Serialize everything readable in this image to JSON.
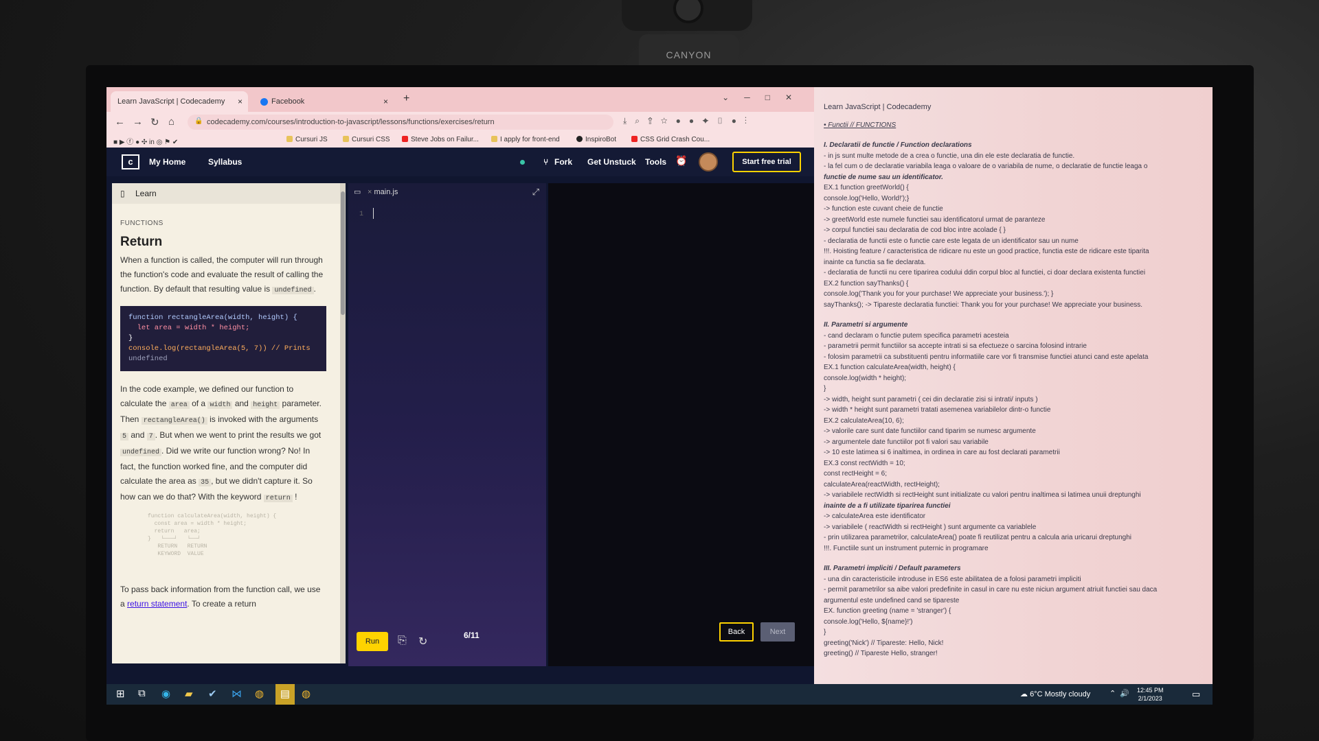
{
  "webcam": {
    "brand": "CANYON"
  },
  "chrome": {
    "tabs": [
      {
        "title": "Learn JavaScript | Codecademy",
        "active": true
      },
      {
        "title": "Facebook",
        "active": false
      }
    ],
    "url": "codecademy.com/courses/introduction-to-javascript/lessons/functions/exercises/return",
    "bookmarks": [
      "Cursuri JS",
      "Cursuri CSS",
      "Steve Jobs on Failur...",
      "I apply for front-end",
      "InspiroBot",
      "CSS Grid Crash Cou..."
    ]
  },
  "codecademy": {
    "nav": {
      "my_home": "My Home",
      "syllabus": "Syllabus",
      "fork": "Fork",
      "get_unstuck": "Get Unstuck",
      "tools": "Tools",
      "cta": "Start free trial"
    },
    "learn": {
      "header": "Learn",
      "kicker": "FUNCTIONS",
      "title": "Return",
      "p1_a": "When a function is called, the computer will run through the function's code and evaluate the result of calling the function. By default that resulting value is",
      "p1_code": "undefined",
      "code_lines": [
        "function rectangleArea(width, height) {",
        "  let area = width * height;",
        "}",
        "console.log(rectangleArea(5, 7)) // Prints",
        "undefined"
      ],
      "p2": [
        "In the code example, we defined our function to calculate the",
        "area",
        "of a",
        "width",
        "and",
        "height",
        "parameter. Then",
        "rectangleArea()",
        "is invoked with the arguments",
        "5",
        "and",
        "7",
        ". But when we went to print the results we got",
        "undefined",
        ". Did we write our function wrong? No! In fact, the function worked fine, and the computer did calculate the area as",
        "35",
        ", but we didn't capture it. So how can we do that? With the keyword",
        "return",
        "!"
      ],
      "diagram": "function calculateArea(width, height) {\n  const area = width * height;\n  return   area;\n}   └───┘   └──┘\n   RETURN   RETURN\n   KEYWORD  VALUE",
      "p3_a": "To pass back information from the function call, we use a",
      "p3_link": "return statement",
      "p3_b": ". To create a return"
    },
    "editor": {
      "file": "main.js",
      "line": "1",
      "run": "Run"
    },
    "footer": {
      "progress": "6/11",
      "back": "Back",
      "next": "Next"
    }
  },
  "notes": {
    "title": "Learn JavaScript | Codecademy",
    "lines": [
      {
        "t": "• Functii // FUNCTIONS",
        "c": "ul it"
      },
      {
        "t": "",
        "c": ""
      },
      {
        "t": "I. Declaratii de functie / Function declarations",
        "c": "sh"
      },
      {
        "t": "- in js sunt multe metode de a crea o functie, una din ele este declaratia de functie.",
        "c": ""
      },
      {
        "t": "- la fel cum o de declaratie variabila leaga o valoare de o variabila de nume, o declaratie de functie leaga o",
        "c": ""
      },
      {
        "t": "functie de nume sau un identificator.",
        "c": "bi"
      },
      {
        "t": "EX.1 function greetWorld() {",
        "c": ""
      },
      {
        "t": "          console.log('Hello, World!');}",
        "c": ""
      },
      {
        "t": "-> function este cuvant cheie de functie",
        "c": ""
      },
      {
        "t": "-> greetWorld este numele functiei sau identificatorul urmat de paranteze",
        "c": ""
      },
      {
        "t": "-> corpul functiei sau declaratia de cod bloc intre acolade { }",
        "c": ""
      },
      {
        "t": "- declaratia de  functii este o functie care este legata de un identificator sau un nume",
        "c": ""
      },
      {
        "t": "!!!. Hoisting feature / caracteristica de ridicare nu este un good practice, functia este de ridicare este tiparita",
        "c": ""
      },
      {
        "t": "inainte ca functia sa fie declarata.",
        "c": ""
      },
      {
        "t": "- declaratia de functii nu cere tiparirea codului ddin corpul bloc al functiei, ci doar declara existenta functiei",
        "c": ""
      },
      {
        "t": "EX.2 function sayThanks() {",
        "c": ""
      },
      {
        "t": "  console.log('Thank you for your purchase! We appreciate your business.'); }",
        "c": ""
      },
      {
        "t": "sayThanks(); -> Tipareste declaratia functiei: Thank you for your purchase! We appreciate your business.",
        "c": ""
      },
      {
        "t": "",
        "c": ""
      },
      {
        "t": "II. Parametri si argumente",
        "c": "sh"
      },
      {
        "t": "- cand declaram o functie putem specifica parametri acesteia",
        "c": ""
      },
      {
        "t": "- parametrii permit functiilor sa accepte intrati si sa efectueze o sarcina folosind intrarie",
        "c": ""
      },
      {
        "t": "- folosim parametrii ca substituenti pentru informatiile care vor fi transmise functiei atunci cand este apelata",
        "c": ""
      },
      {
        "t": "EX.1 function calculateArea(width, height) {",
        "c": ""
      },
      {
        "t": "          console.log(width * height);",
        "c": ""
      },
      {
        "t": "}",
        "c": ""
      },
      {
        "t": "-> width, height sunt parametri ( cei din declaratie zisi si intrati/ inputs )",
        "c": ""
      },
      {
        "t": "-> width * height sunt parametri tratati asemenea variabilelor dintr-o functie",
        "c": ""
      },
      {
        "t": "EX.2 calculateArea(10, 6);",
        "c": ""
      },
      {
        "t": "-> valorile care sunt date functiilor cand tiparim se numesc argumente",
        "c": ""
      },
      {
        "t": "-> argumentele date functiilor pot fi valori sau variabile",
        "c": ""
      },
      {
        "t": "-> 10 este latimea si 6 inaltimea, in ordinea in care au fost declarati parametrii",
        "c": ""
      },
      {
        "t": "EX.3 const rectWidth = 10;",
        "c": ""
      },
      {
        "t": "        const rectHeight = 6;",
        "c": ""
      },
      {
        "t": "        calculateArea(reactWidth, rectHeight);",
        "c": ""
      },
      {
        "t": "-> variabilele rectWidth si rectHeight sunt initializate cu valori pentru inaltimea si latimea unuii dreptunghi",
        "c": ""
      },
      {
        "t": "inainte de a fi utilizate tiparirea functiei",
        "c": "bi"
      },
      {
        "t": "-> calculateArea este identificator",
        "c": ""
      },
      {
        "t": "-> variabilele ( reactWidth si rectHeight ) sunt argumente ca variablele",
        "c": ""
      },
      {
        "t": "- prin utilizarea parametrilor, calculateArea() poate fi reutilizat pentru a calcula aria uricarui dreptunghi",
        "c": ""
      },
      {
        "t": "!!!. Functiile sunt un instrument puternic in programare",
        "c": ""
      },
      {
        "t": "",
        "c": ""
      },
      {
        "t": "III. Parametri impliciti / Default parameters",
        "c": "sh"
      },
      {
        "t": "- una din caracteristicile introduse in ES6 este abilitatea de a folosi parametri impliciti",
        "c": ""
      },
      {
        "t": "- permit parametrilor sa aibe valori predefinite in casul in care nu este niciun argument atriuit functiei sau daca",
        "c": ""
      },
      {
        "t": "argumentul este undefined cand se tipareste",
        "c": ""
      },
      {
        "t": "EX. function greeting (name = 'stranger') {",
        "c": ""
      },
      {
        "t": "        console.log('Hello, ${name}!')",
        "c": ""
      },
      {
        "t": "}",
        "c": ""
      },
      {
        "t": "greeting('Nick') // Tipareste: Hello, Nick!",
        "c": ""
      },
      {
        "t": "greeting()          // Tipareste Hello, stranger!",
        "c": ""
      }
    ]
  },
  "taskbar": {
    "weather": "6°C  Mostly cloudy",
    "time": "12:45 PM",
    "date": "2/1/2023"
  }
}
